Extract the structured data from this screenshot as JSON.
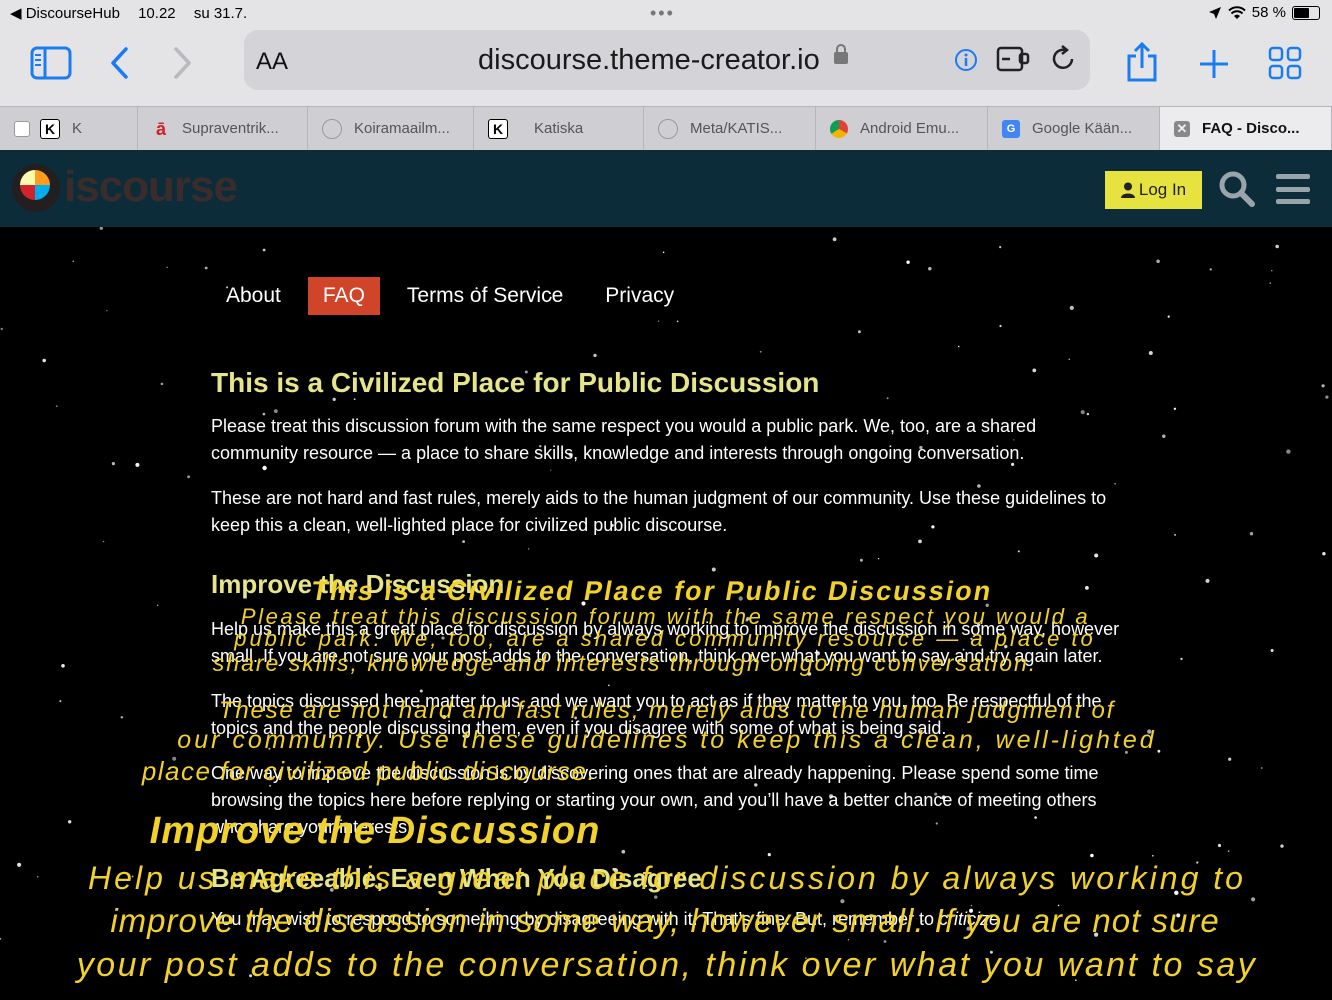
{
  "status_bar": {
    "back_app": "◀ DiscourseHub",
    "time": "10.22",
    "date": "su 31.7.",
    "battery": "58 %"
  },
  "browser": {
    "text_size_label": "AA",
    "url": "discourse.theme-creator.io",
    "tabs": [
      {
        "label": "K",
        "icon": "k-favicon"
      },
      {
        "label": "Supraventrik...",
        "icon": "supra-favicon"
      },
      {
        "label": "Koiramaailm...",
        "icon": "bubble-favicon"
      },
      {
        "label": "Katiska",
        "icon": "k-favicon"
      },
      {
        "label": "Meta/KATIS...",
        "icon": "bubble-favicon"
      },
      {
        "label": "Android Emu...",
        "icon": "android-favicon"
      },
      {
        "label": "Google Kään...",
        "icon": "google-translate-favicon"
      },
      {
        "label": "FAQ - Disco...",
        "icon": "close-icon"
      }
    ]
  },
  "header": {
    "logo_text": "iscourse",
    "login_label": "Log In"
  },
  "nav": {
    "items": [
      "About",
      "FAQ",
      "Terms of Service",
      "Privacy"
    ],
    "active": "FAQ"
  },
  "article": {
    "title": "This is a Civilized Place for Public Discussion",
    "p1": "Please treat this discussion forum with the same respect you would a public park. We, too, are a shared community resource — a place to share skills, knowledge and interests through ongoing conversation.",
    "p2": "These are not hard and fast rules, merely aids to the human judgment of our community. Use these guidelines to keep this a clean, well-lighted place for civilized public discourse.",
    "h2_improve": "Improve the Discussion",
    "p3": "Help us make this a great place for discussion by always working to improve the discussion in some way, however small. If you are not sure your post adds to the conversation, think over what you want to say and try again later.",
    "p4": "The topics discussed here matter to us, and we want you to act as if they matter to you, too. Be respectful of the topics and the people discussing them, even if you disagree with some of what is being said.",
    "p5": "One way to improve the discussion is by discovering ones that are already happening. Please spend some time browsing the topics here before replying or starting your own, and you’ll have a better chance of meeting others who share your interests.",
    "h2_agree": "Be Agreeable, Even When You Disagree",
    "p6_start": "You may wish to respond to something by disagreeing with it. That’s fine. But, remember to ",
    "p6_em": "criticize"
  },
  "crawl": {
    "lines": [
      "This is a Civilized Place for Public Discussion",
      "Please treat this discussion forum with the same respect you would a",
      "public park. We, too, are a shared community resource — a place to",
      "share skills, knowledge and interests through ongoing conversation.",
      "These are not hard and fast rules, merely aids to the human judgment of",
      "our community. Use these guidelines to keep this a clean, well-lighted",
      "place for civilized public discourse.",
      "Improve the Discussion",
      "Help us make this a great place for discussion by always working to",
      "improve the discussion in some way, however small. If you are not sure",
      "your post adds to the conversation, think over what you want to say"
    ]
  },
  "colors": {
    "header_bg": "#0d2c3a",
    "login_bg": "#e6e341",
    "nav_active_bg": "#d0452a",
    "heading": "#e6e58a",
    "crawl": "#f2d22a",
    "safari_blue": "#1a7cf0"
  }
}
